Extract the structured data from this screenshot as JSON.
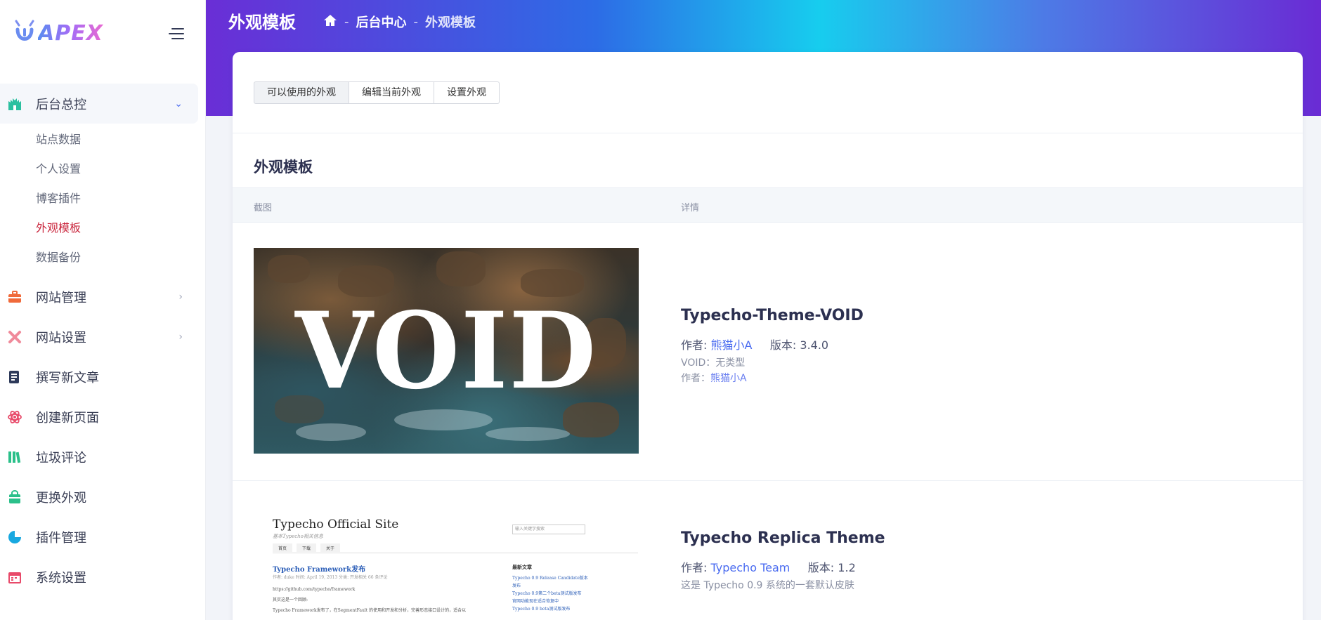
{
  "brand": {
    "logo_text": "APEX"
  },
  "sidebar": {
    "menu": [
      {
        "label": "后台总控",
        "icon": "castle-icon",
        "color": "#2bc0a0",
        "expanded": true,
        "children": [
          {
            "label": "站点数据"
          },
          {
            "label": "个人设置"
          },
          {
            "label": "博客插件"
          },
          {
            "label": "外观模板",
            "current": true
          },
          {
            "label": "数据备份"
          }
        ]
      },
      {
        "label": "网站管理",
        "icon": "briefcase-icon",
        "color": "#f06a3a"
      },
      {
        "label": "网站设置",
        "icon": "tools-icon",
        "color": "#f08a9a"
      },
      {
        "label": "撰写新文章",
        "icon": "document-icon",
        "color": "#2d3a5a"
      },
      {
        "label": "创建新页面",
        "icon": "atom-icon",
        "color": "#e84a6a"
      },
      {
        "label": "垃圾评论",
        "icon": "library-icon",
        "color": "#2bc08a"
      },
      {
        "label": "更换外观",
        "icon": "bag-icon",
        "color": "#2bc08a"
      },
      {
        "label": "插件管理",
        "icon": "pie-chart-icon",
        "color": "#18a8e0"
      },
      {
        "label": "系统设置",
        "icon": "calendar-icon",
        "color": "#e84a6a"
      }
    ]
  },
  "header": {
    "title": "外观模板",
    "breadcrumb": {
      "home_icon": "home-icon",
      "sep": "-",
      "parent": "后台中心",
      "current": "外观模板"
    }
  },
  "tabs": [
    {
      "label": "可以使用的外观",
      "active": true
    },
    {
      "label": "编辑当前外观"
    },
    {
      "label": "设置外观"
    }
  ],
  "section": {
    "title": "外观模板"
  },
  "table": {
    "headers": [
      "截图",
      "详情"
    ],
    "rows": [
      {
        "thumb_text": "VOID",
        "name": "Typecho-Theme-VOID",
        "author_label": "作者:",
        "author": "熊猫小A",
        "version_label": "版本:",
        "version": "3.4.0",
        "line1": "VOID：无类型",
        "line2_label": "作者：",
        "line2_author": "熊猫小A"
      },
      {
        "name": "Typecho Replica Theme",
        "author_label": "作者:",
        "author": "Typecho Team",
        "version_label": "版本:",
        "version": "1.2",
        "line1": "这是 Typecho 0.9 系统的一套默认皮肤",
        "thumb": {
          "site_title": "Typecho Official Site",
          "site_subtitle": "基本Typecho相关信息",
          "search_placeholder": "输入关键字搜索",
          "nav": [
            "首页",
            "下载",
            "关于"
          ],
          "post_title": "Typecho Framework发布",
          "post_meta": "作者: duke   时间: April 19, 2013   分类: 开发相关   66 条评论",
          "post_body_1": "https://github.com/typecho/framework",
          "post_body_2": "其实这是一个回顾:",
          "post_body_3": "Typecho Framework发布了，在SegmentFault 的使用和开发和分析，完善形态接口设计的，适合以",
          "side_title": "最新文章",
          "side_1": "Typecho 0.9 Release Candidate版本发布",
          "side_2": "Typecho 0.9第二个beta测试版发布",
          "side_3": "官网功能现在适合恢复中",
          "side_4": "Typecho 0.9 beta测试版发布"
        }
      }
    ]
  }
}
